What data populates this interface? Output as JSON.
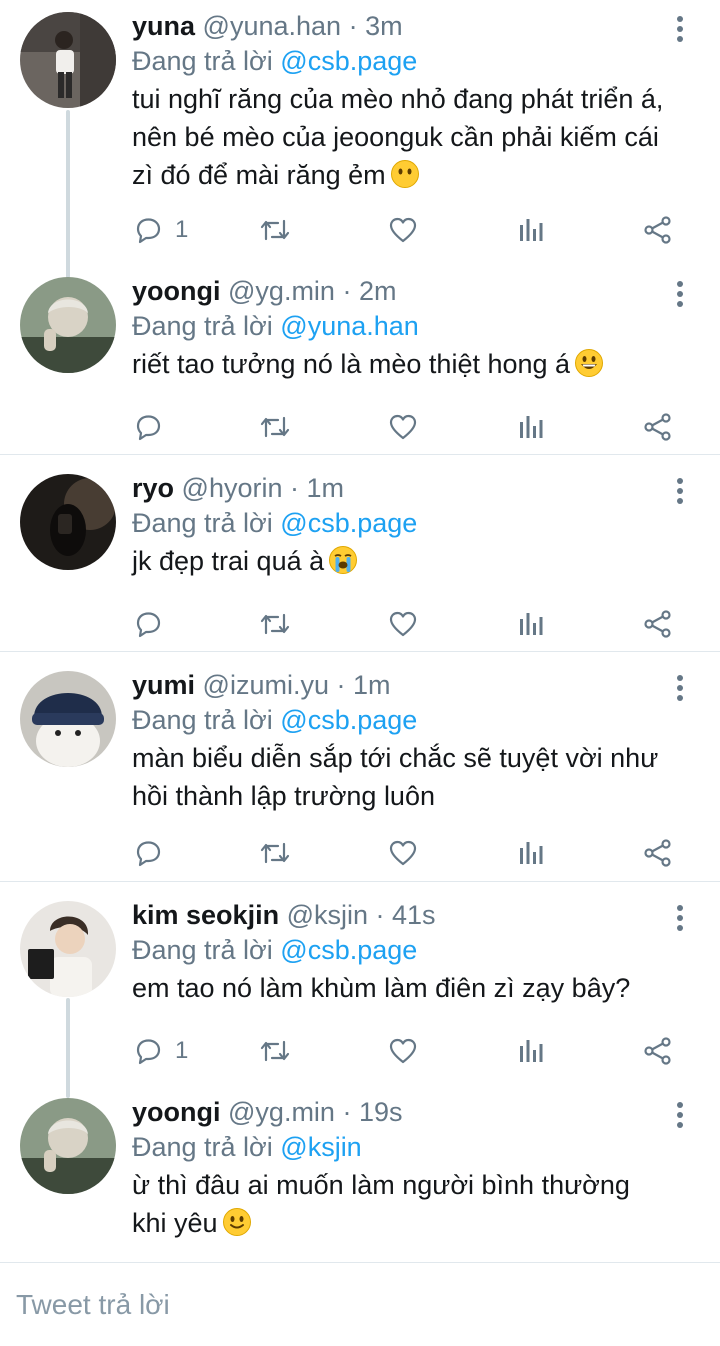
{
  "tweets": [
    {
      "name": "yuna",
      "handle": "@yuna.han",
      "time": "· 3m",
      "reply_label": "Đang trả lời",
      "reply_to": "@csb.page",
      "text_lines": [
        "tui nghĩ răng của mèo nhỏ đang phát triển á,",
        "nên bé mèo của jeoonguk cần phải kiếm cái",
        "zì đó để mài răng ẻm"
      ],
      "emoji": "no-mouth-face",
      "reply_count": "1",
      "avatar": "photo-girl-standing"
    },
    {
      "name": "yoongi",
      "handle": "@yg.min",
      "time": "· 2m",
      "reply_label": "Đang trả lời",
      "reply_to": "@yuna.han",
      "text_lines": [
        "riết tao tưởng nó là mèo thiệt hong á"
      ],
      "emoji": "grinning-face",
      "reply_count": "",
      "avatar": "photo-yoongi"
    },
    {
      "name": "ryo",
      "handle": "@hyorin",
      "time": "· 1m",
      "reply_label": "Đang trả lời",
      "reply_to": "@csb.page",
      "text_lines": [
        "jk đẹp trai quá à"
      ],
      "emoji": "loudly-crying-face",
      "reply_count": "",
      "avatar": "photo-dark-silhouette"
    },
    {
      "name": "yumi",
      "handle": "@izumi.yu",
      "time": "· 1m",
      "reply_label": "Đang trả lời",
      "reply_to": "@csb.page",
      "text_lines": [
        "màn biểu diễn sắp tới chắc sẽ tuyệt vời như",
        "hồi thành lập trường luôn"
      ],
      "emoji": "",
      "reply_count": "",
      "avatar": "photo-plush-beanie"
    },
    {
      "name": "kim seokjin",
      "handle": "@ksjin",
      "time": "· 41s",
      "reply_label": "Đang trả lời",
      "reply_to": "@csb.page",
      "text_lines": [
        "em tao nó làm khùm làm điên zì zạy bây?"
      ],
      "emoji": "",
      "reply_count": "1",
      "avatar": "photo-seokjin-book"
    },
    {
      "name": "yoongi",
      "handle": "@yg.min",
      "time": "· 19s",
      "reply_label": "Đang trả lời",
      "reply_to": "@ksjin",
      "text_lines": [
        "ừ thì đâu ai muốn làm người bình thường",
        "khi yêu"
      ],
      "emoji": "slightly-smiling-face",
      "reply_count": "",
      "avatar": "photo-yoongi"
    }
  ],
  "compose": {
    "placeholder": "Tweet trả lời"
  },
  "icons": [
    "reply-icon",
    "retweet-icon",
    "like-icon",
    "stats-icon",
    "share-icon",
    "more-icon"
  ],
  "colors": {
    "link": "#1da1f2",
    "secondary": "#657786",
    "thread_line": "#cfd9de"
  }
}
